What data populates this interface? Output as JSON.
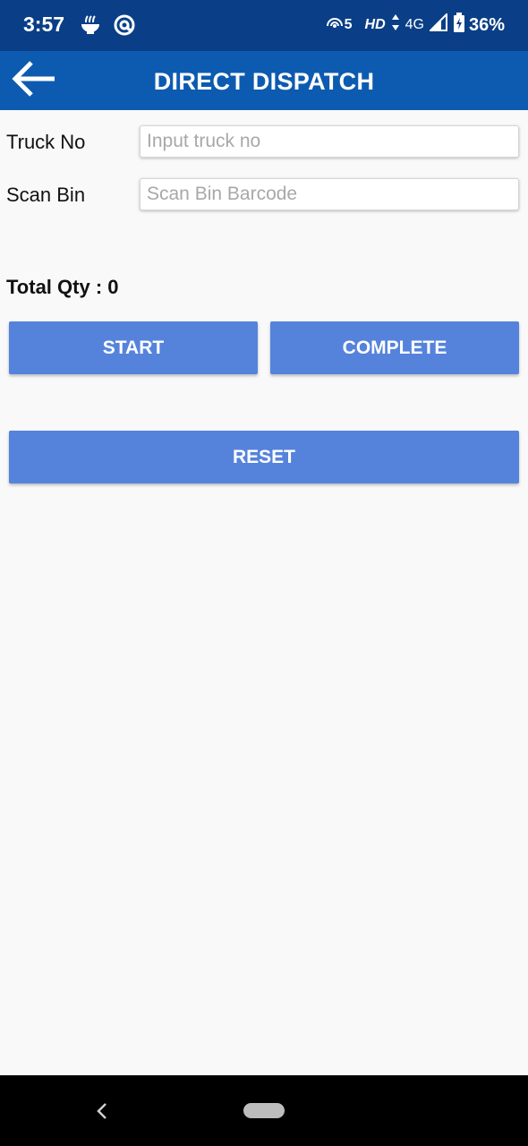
{
  "status_bar": {
    "time": "3:57",
    "left_icons": [
      "noodle-bowl-icon",
      "at-sign-icon"
    ],
    "hotspot_label": "5",
    "hd_label": "HD",
    "network_label": "4G",
    "battery_percent": "36%"
  },
  "app_bar": {
    "title": "DIRECT DISPATCH",
    "back_icon": "arrow-left-icon"
  },
  "form": {
    "truck_no": {
      "label": "Truck No",
      "value": "",
      "placeholder": "Input truck no"
    },
    "scan_bin": {
      "label": "Scan Bin",
      "value": "",
      "placeholder": "Scan Bin Barcode"
    }
  },
  "total_qty": "Total Qty : 0",
  "buttons": {
    "start": "START",
    "complete": "COMPLETE",
    "reset": "RESET"
  },
  "colors": {
    "status_bar": "#0a3f87",
    "app_bar": "#0d5bb0",
    "button": "#5583dc",
    "background": "#f9f9f9"
  }
}
